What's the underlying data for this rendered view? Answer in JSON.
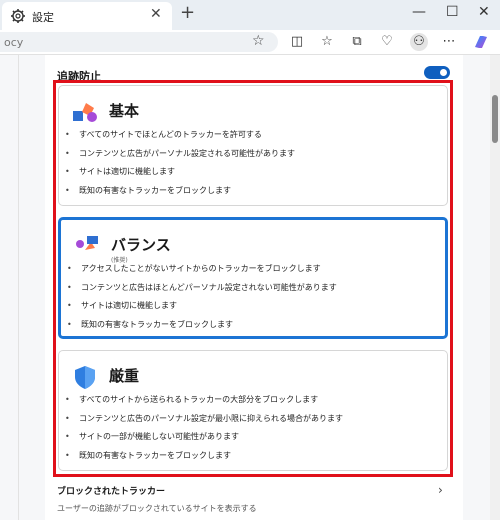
{
  "tab": {
    "title": "設定",
    "close": "✕",
    "new": "+"
  },
  "window": {
    "minimize": "—",
    "maximize": "☐",
    "close": "✕"
  },
  "address": {
    "url": "ocy"
  },
  "tracking": {
    "title": "追跡防止",
    "enabled": true,
    "levels": [
      {
        "name": "基本",
        "sub": "",
        "bullets": [
          "すべてのサイトでほとんどのトラッカーを許可する",
          "コンテンツと広告がパーソナル設定される可能性があります",
          "サイトは適切に機能します",
          "既知の有害なトラッカーをブロックします"
        ]
      },
      {
        "name": "バランス",
        "sub": "(推奨)",
        "bullets": [
          "アクセスしたことがないサイトからのトラッカーをブロックします",
          "コンテンツと広告はほとんどパーソナル設定されない可能性があります",
          "サイトは適切に機能します",
          "既知の有害なトラッカーをブロックします"
        ]
      },
      {
        "name": "厳重",
        "sub": "",
        "bullets": [
          "すべてのサイトから送られるトラッカーの大部分をブロックします",
          "コンテンツと広告のパーソナル設定が最小限に抑えられる場合があります",
          "サイトの一部が機能しない可能性があります",
          "既知の有害なトラッカーをブロックします"
        ]
      }
    ],
    "selected": "バランス"
  },
  "blocked": {
    "title": "ブロックされたトラッカー",
    "desc": "ユーザーの追跡がブロックされているサイトを表示する"
  },
  "colors": {
    "accent": "#1c74d4",
    "highlight": "#e0101a",
    "toggle": "#0f5fbf"
  }
}
